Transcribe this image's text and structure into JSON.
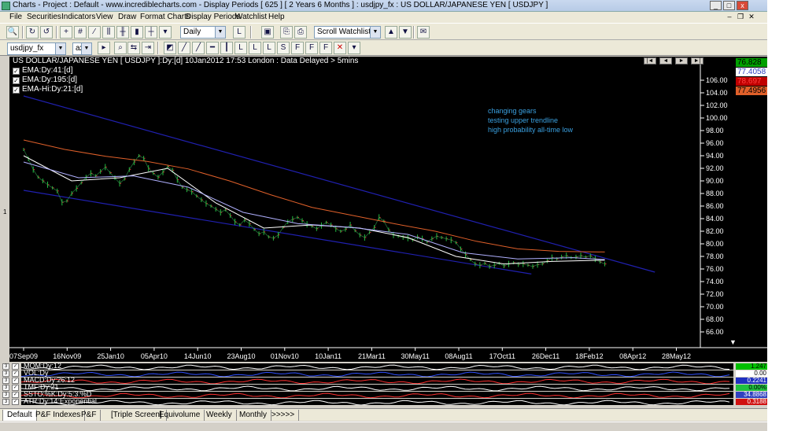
{
  "window": {
    "title": "Charts - Project : Default - www.incrediblecharts.com - Display Periods  [ 625 ]  [ 2 Years 6 Months ] : usdjpy_fx : US DOLLAR/JAPANESE YEN  [ USDJPY ]",
    "minimize": "_",
    "maximize": "□",
    "close": "x"
  },
  "menu": {
    "items": [
      "File",
      "Securities",
      "Indicators",
      "View",
      "Draw",
      "Format Charts",
      "Display Periods",
      "Watchlist",
      "Help"
    ]
  },
  "toolbar1": {
    "period": "Daily",
    "watchlist": "Scroll Watchlist"
  },
  "toolbar2": {
    "symbol": "usdjpy_fx",
    "exchange": "ax"
  },
  "chart": {
    "header": "US DOLLAR/JAPANESE YEN [ USDJPY ]:Dy:[d]  10Jan2012 17:53 London : Data Delayed > 5mins",
    "legend": [
      {
        "label": "EMA:Dy:41:[d]",
        "color": "#ffffff"
      },
      {
        "label": "EMA:Dy:195:[d]",
        "color": "#ffffff"
      },
      {
        "label": "EMA-Hi:Dy:21:[d]",
        "color": "#ffffff"
      }
    ],
    "annotations": [
      "changing gears",
      "testing upper trendline",
      "high probability all-time low"
    ],
    "price_badges": [
      {
        "value": "76.828",
        "bg": "#00a000",
        "fg": "#000000"
      },
      {
        "value": "77.4058",
        "bg": "#ffffff",
        "fg": "#3040c0"
      },
      {
        "value": "78.697",
        "bg": "#c00000",
        "fg": "#ff4040"
      },
      {
        "value": "77.4956",
        "bg": "#e0602a",
        "fg": "#000000"
      }
    ],
    "nav": [
      "|◄",
      "◄",
      "►",
      "►|"
    ]
  },
  "chart_data": {
    "type": "line",
    "title": "US DOLLAR/JAPANESE YEN [ USDJPY ]",
    "x_tick_labels": [
      "07Sep09",
      "16Nov09",
      "25Jan10",
      "05Apr10",
      "14Jun10",
      "23Aug10",
      "01Nov10",
      "10Jan11",
      "21Mar11",
      "30May11",
      "08Aug11",
      "17Oct11",
      "26Dec11",
      "18Feb12",
      "08Apr12",
      "28May12"
    ],
    "y_tick_labels": [
      "106.00",
      "104.00",
      "102.00",
      "100.00",
      "98.00",
      "96.00",
      "94.00",
      "92.00",
      "90.00",
      "88.00",
      "86.00",
      "84.00",
      "82.00",
      "80.00",
      "78.00",
      "76.00",
      "74.00",
      "72.00",
      "70.00",
      "68.00",
      "66.00"
    ],
    "ylim": [
      64.5,
      108
    ],
    "series": [
      {
        "name": "US DOLLAR/JAPANESE YEN [ USDJPY ]",
        "color": "#20c040",
        "x": [
          0,
          7,
          14,
          21,
          28,
          35,
          42,
          49,
          56,
          63,
          70,
          77,
          84,
          91,
          98,
          105,
          112,
          119,
          126,
          133,
          140,
          147,
          154,
          161,
          168,
          175,
          182,
          189,
          196,
          203,
          210,
          217,
          224,
          231,
          238,
          245,
          252,
          259,
          266,
          273,
          280,
          287,
          294,
          301,
          308,
          315,
          322,
          329,
          336,
          343,
          350,
          357,
          364,
          371,
          378,
          385,
          392,
          399,
          406,
          413,
          420,
          427,
          434,
          441,
          448,
          455,
          462,
          469,
          476,
          483,
          490,
          497,
          504,
          511,
          518,
          525,
          532,
          539,
          546,
          553,
          560,
          567,
          574,
          581,
          588,
          595,
          602,
          609,
          616,
          623,
          630,
          637,
          644,
          651,
          658,
          665,
          672,
          679,
          686,
          693,
          700,
          707,
          714,
          721,
          728,
          735,
          742,
          749,
          756,
          763,
          770,
          777,
          784,
          791,
          798,
          805,
          812,
          819,
          826,
          833,
          840,
          847
        ],
        "y": [
          95.0,
          93.5,
          91.8,
          90.6,
          90.0,
          89.4,
          88.9,
          88.4,
          86.6,
          86.8,
          88.0,
          88.8,
          89.7,
          90.6,
          91.2,
          90.8,
          91.5,
          92.2,
          91.3,
          90.5,
          89.6,
          90.3,
          91.8,
          93.0,
          94.0,
          93.6,
          92.0,
          91.2,
          90.6,
          91.4,
          92.3,
          91.7,
          90.2,
          89.0,
          88.6,
          88.3,
          87.6,
          87.0,
          86.4,
          86.0,
          85.5,
          85.0,
          85.4,
          84.5,
          83.5,
          83.0,
          83.8,
          83.2,
          82.3,
          81.6,
          81.9,
          81.1,
          80.9,
          81.4,
          82.6,
          83.5,
          83.9,
          84.2,
          83.7,
          83.1,
          82.8,
          82.4,
          82.9,
          83.4,
          83.0,
          82.4,
          82.0,
          82.3,
          83.0,
          82.1,
          81.4,
          81.0,
          81.8,
          82.6,
          84.2,
          83.6,
          82.2,
          81.4,
          81.2,
          81.0,
          80.9,
          80.6,
          81.1,
          80.8,
          80.3,
          80.8,
          81.2,
          81.0,
          80.8,
          80.6,
          80.2,
          79.2,
          78.3,
          77.5,
          76.8,
          76.6,
          76.9,
          76.4,
          76.6,
          76.9,
          76.5,
          76.8,
          77.0,
          76.7,
          76.8,
          76.6,
          76.4,
          76.7,
          76.8,
          77.3,
          77.8,
          77.6,
          77.9,
          78.1,
          77.8,
          77.9,
          78.1,
          77.9,
          78.1,
          77.6,
          77.1,
          76.8
        ]
      },
      {
        "name": "EMA:Dy:41:[d]",
        "color": "#ffffff",
        "x": [
          0,
          70,
          140,
          210,
          280,
          350,
          420,
          490,
          560,
          630,
          700,
          770,
          847
        ],
        "y": [
          94.0,
          90.0,
          90.5,
          92.0,
          86.5,
          82.5,
          83.0,
          82.5,
          81.0,
          78.0,
          76.8,
          77.2,
          77.4
        ]
      },
      {
        "name": "EMA:Dy:195:[d]",
        "color": "#ffffff",
        "x": [
          0,
          80,
          160,
          240,
          320,
          400,
          480,
          560,
          640,
          720,
          800,
          847
        ],
        "y": [
          93.0,
          90.5,
          90.8,
          89.0,
          85.0,
          83.2,
          82.6,
          81.5,
          78.6,
          77.6,
          77.8,
          77.5
        ]
      },
      {
        "name": "EMA-Hi:Dy:21:[d]",
        "color": "#e0602a",
        "x": [
          0,
          60,
          120,
          180,
          240,
          300,
          360,
          420,
          480,
          540,
          600,
          660,
          720,
          780,
          847
        ],
        "y": [
          96.5,
          95.0,
          93.9,
          93.1,
          91.9,
          90.0,
          87.8,
          85.8,
          84.5,
          83.2,
          82.0,
          80.4,
          79.2,
          78.8,
          78.7
        ]
      }
    ],
    "trendlines": [
      {
        "color": "#2020b0",
        "x": [
          0,
          920
        ],
        "y": [
          103.5,
          75.5
        ]
      },
      {
        "color": "#2020b0",
        "x": [
          0,
          740
        ],
        "y": [
          88.5,
          75.2
        ]
      }
    ]
  },
  "indicators": [
    {
      "label": "MOM:Dy:12",
      "value": "1.247",
      "value_bg": "#00c000",
      "value_fg": "#000000",
      "line": "#ffffff"
    },
    {
      "label": "VOL:Dy",
      "value": "0.00",
      "value_bg": "#ffffff",
      "value_fg": "#000000",
      "line": "#3050ff"
    },
    {
      "label": "MACD:Dy:26:12",
      "value": "0.2241",
      "value_bg": "#2030c0",
      "value_fg": "#ffffff",
      "line": "#ff3030"
    },
    {
      "label": "TMF:Dy:21",
      "value": "0.00%",
      "value_bg": "#20c040",
      "value_fg": "#000000",
      "line": "#ffffff"
    },
    {
      "label": "SSTO:%K:Dy:5:3:%D",
      "value": "34.8868",
      "value_bg": "#3040c0",
      "value_fg": "#ffffff",
      "line": "#ff3030"
    },
    {
      "label": "ATR:Dy:14:Exponential",
      "value": "0.3188",
      "value_bg": "#d01010",
      "value_fg": "#ffffff",
      "line": "#ffffff"
    }
  ],
  "tabs": [
    "Default",
    "P&F Indexes",
    "P&F",
    "[Triple Screen]",
    "Equivolume",
    "Weekly",
    "Monthly",
    ">>>>>"
  ]
}
